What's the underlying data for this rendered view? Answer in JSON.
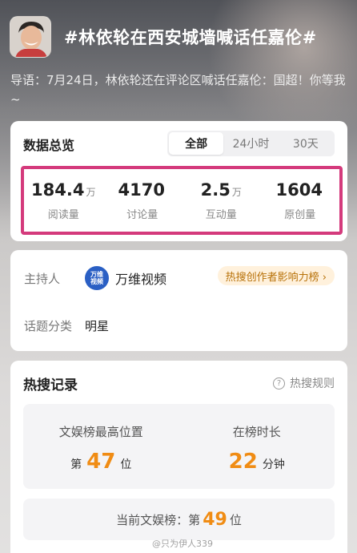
{
  "header": {
    "title": "#林依轮在西安城墙喊话任嘉伦#",
    "intro": "导语：7月24日，林依轮还在评论区喊话任嘉伦：国超！你等我 ~"
  },
  "overview": {
    "title": "数据总览",
    "tabs": [
      "全部",
      "24小时",
      "30天"
    ],
    "active_tab": "全部",
    "stats": [
      {
        "value": "184.4",
        "unit": "万",
        "label": "阅读量"
      },
      {
        "value": "4170",
        "unit": "",
        "label": "讨论量"
      },
      {
        "value": "2.5",
        "unit": "万",
        "label": "互动量"
      },
      {
        "value": "1604",
        "unit": "",
        "label": "原创量"
      }
    ]
  },
  "info": {
    "host_key": "主持人",
    "host_logo_top": "万维",
    "host_logo_bottom": "视频",
    "host_name": "万维视频",
    "hot_badge": "热搜创作者影响力榜 ›",
    "category_key": "话题分类",
    "category_value": "明星"
  },
  "record": {
    "title": "热搜记录",
    "rules": "热搜规则",
    "highest_label": "文娱榜最高位置",
    "highest_prefix": "第",
    "highest_value": "47",
    "highest_suffix": "位",
    "duration_label": "在榜时长",
    "duration_value": "22",
    "duration_unit": "分钟",
    "current_prefix": "当前文娱榜：第",
    "current_value": "49",
    "current_suffix": "位"
  },
  "watermark": "@只为伊人339",
  "colors": {
    "highlight_border": "#d43a7c",
    "accent_orange": "#f08c14",
    "badge_bg": "#fff1dc"
  }
}
